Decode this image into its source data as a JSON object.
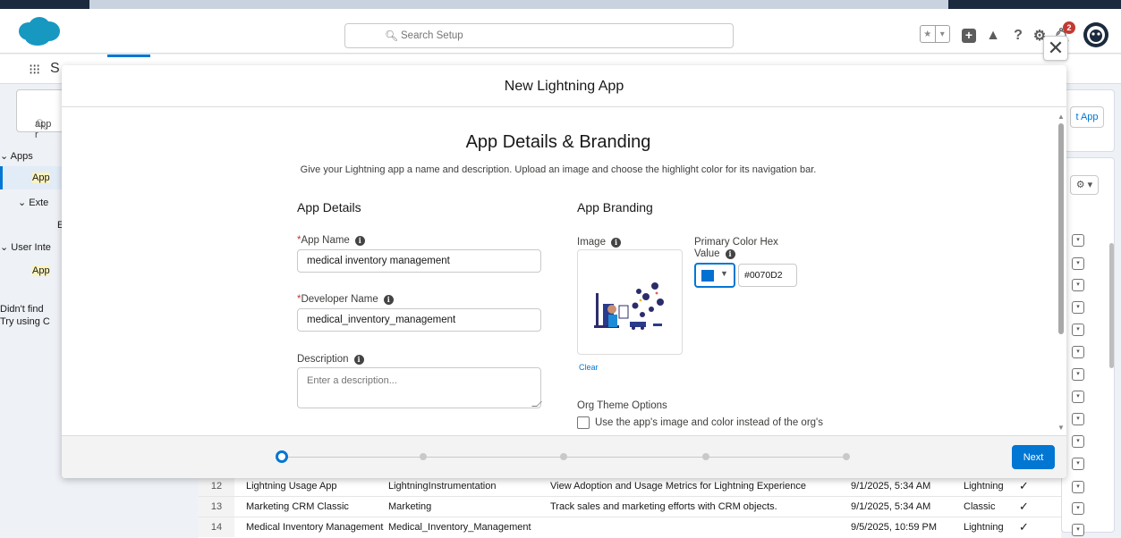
{
  "header": {
    "search_placeholder": "Search Setup",
    "notification_count": "2"
  },
  "navbar": {
    "title": "S"
  },
  "left": {
    "quick_find_value": "app r",
    "tree": [
      {
        "label": "Apps"
      },
      {
        "label": "App"
      },
      {
        "label": "Exte"
      },
      {
        "label": "E"
      },
      {
        "label": "User Inte"
      },
      {
        "label": "App"
      }
    ],
    "not_found_1": "Didn't find",
    "not_found_2": "Try using C"
  },
  "right": {
    "new_app_label": "t App",
    "gear_label": "⚙ ▾"
  },
  "modal": {
    "title": "New Lightning App",
    "section_title": "App Details & Branding",
    "section_subtitle": "Give your Lightning app a name and description. Upload an image and choose the highlight color for its navigation bar.",
    "details_heading": "App Details",
    "branding_heading": "App Branding",
    "app_name_label": "App Name",
    "app_name_value": "medical inventory management",
    "developer_name_label": "Developer Name",
    "developer_name_value": "medical_inventory_management",
    "description_label": "Description",
    "description_placeholder": "Enter a description...",
    "image_label": "Image",
    "clear_label": "Clear",
    "primary_color_label_1": "Primary Color Hex",
    "primary_color_label_2": "Value",
    "primary_color_value": "#0070D2",
    "org_theme_label": "Org Theme Options",
    "org_theme_checkbox_label": "Use the app's image and color instead of the org's",
    "next_label": "Next",
    "progress": {
      "total_steps": 5,
      "current_step": 1
    }
  },
  "table": {
    "rows": [
      {
        "num": "12",
        "name": "Lightning Usage App",
        "dev": "LightningInstrumentation",
        "desc": "View Adoption and Usage Metrics for Lightning Experience",
        "date": "9/1/2025, 5:34 AM",
        "type": "Lightning",
        "check": "✓"
      },
      {
        "num": "13",
        "name": "Marketing CRM Classic",
        "dev": "Marketing",
        "desc": "Track sales and marketing efforts with CRM objects.",
        "date": "9/1/2025, 5:34 AM",
        "type": "Classic",
        "check": "✓"
      },
      {
        "num": "14",
        "name": "Medical Inventory Management",
        "dev": "Medical_Inventory_Management",
        "desc": "",
        "date": "9/5/2025, 10:59 PM",
        "type": "Lightning",
        "check": "✓"
      }
    ]
  },
  "colors": {
    "brand": "#0176d3",
    "primary_swatch": "#0070d2",
    "cloud": "#1798c1"
  }
}
